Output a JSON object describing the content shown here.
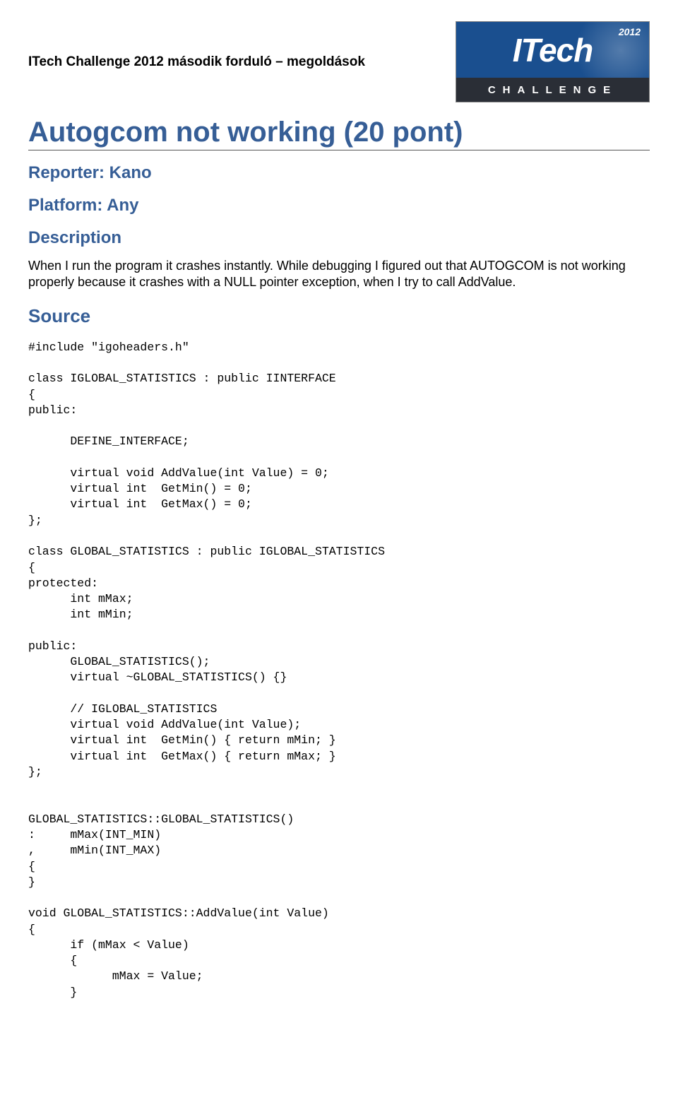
{
  "header": {
    "text": "ITech Challenge 2012 második forduló – megoldások",
    "logo": {
      "year": "2012",
      "brand": "ITech",
      "subtitle": "CHALLENGE"
    }
  },
  "title": "Autogcom not working (20 pont)",
  "reporter": "Reporter: Kano",
  "platform": "Platform: Any",
  "descriptionHeading": "Description",
  "description": "When I run the program it crashes instantly. While debugging I figured out that AUTOGCOM is not working properly because it crashes with a NULL pointer exception, when I try to call AddValue.",
  "sourceHeading": "Source",
  "code": "#include \"igoheaders.h\"\n\nclass IGLOBAL_STATISTICS : public IINTERFACE\n{\npublic:\n\n      DEFINE_INTERFACE;\n\n      virtual void AddValue(int Value) = 0;\n      virtual int  GetMin() = 0;\n      virtual int  GetMax() = 0;\n};\n\nclass GLOBAL_STATISTICS : public IGLOBAL_STATISTICS\n{\nprotected:\n      int mMax;\n      int mMin;\n\npublic:\n      GLOBAL_STATISTICS();\n      virtual ~GLOBAL_STATISTICS() {}\n\n      // IGLOBAL_STATISTICS\n      virtual void AddValue(int Value);\n      virtual int  GetMin() { return mMin; }\n      virtual int  GetMax() { return mMax; }\n};\n\n\nGLOBAL_STATISTICS::GLOBAL_STATISTICS()\n:     mMax(INT_MIN)\n,     mMin(INT_MAX)\n{\n}\n\nvoid GLOBAL_STATISTICS::AddValue(int Value)\n{\n      if (mMax < Value)\n      {\n            mMax = Value;\n      }"
}
